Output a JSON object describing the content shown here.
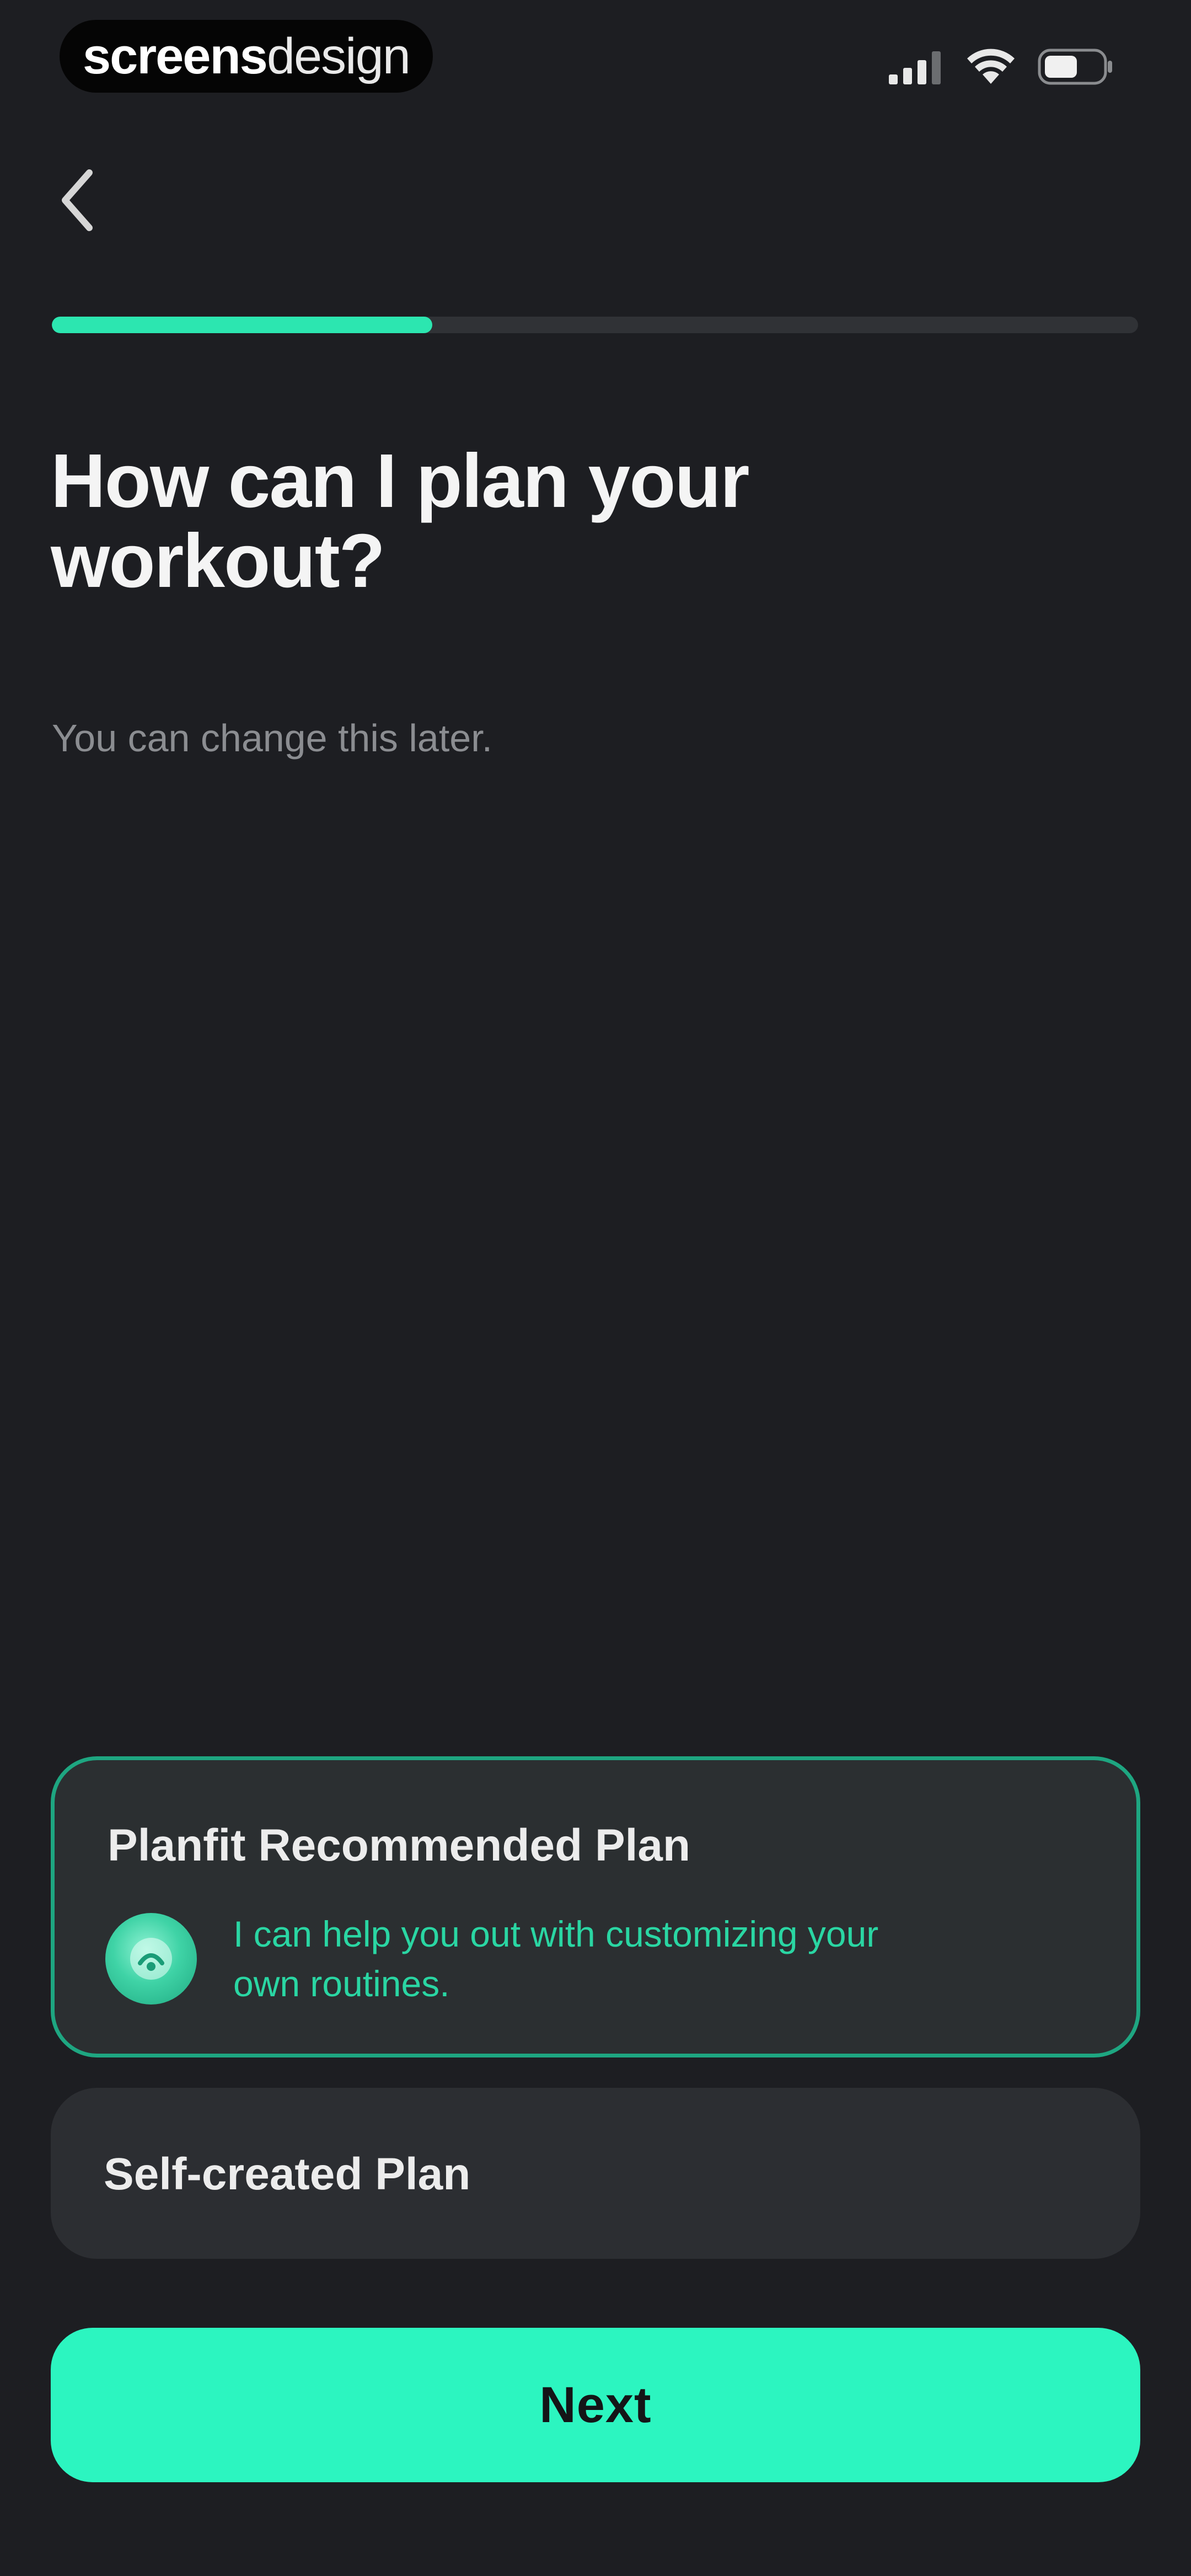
{
  "status_bar": {
    "watermark_bold": "screens",
    "watermark_light": "design",
    "icons": [
      "signal-icon",
      "wifi-icon",
      "battery-icon"
    ]
  },
  "navigation": {
    "back_icon": "chevron-left-icon"
  },
  "progress": {
    "fraction": 0.35,
    "color": "#2ce6b0"
  },
  "header": {
    "title": "How can I plan your workout?",
    "subtitle": "You can change this later."
  },
  "options": [
    {
      "title": "Planfit Recommended Plan",
      "selected": true,
      "description": "I can help you out with customizing your own routines.",
      "icon": "coach-avatar-icon"
    },
    {
      "title": "Self-created Plan",
      "selected": false
    }
  ],
  "footer": {
    "next_label": "Next"
  },
  "colors": {
    "background": "#1d1e22",
    "accent": "#2cf5c0",
    "card": "#2c2e32",
    "selected_border": "#1ea681"
  }
}
